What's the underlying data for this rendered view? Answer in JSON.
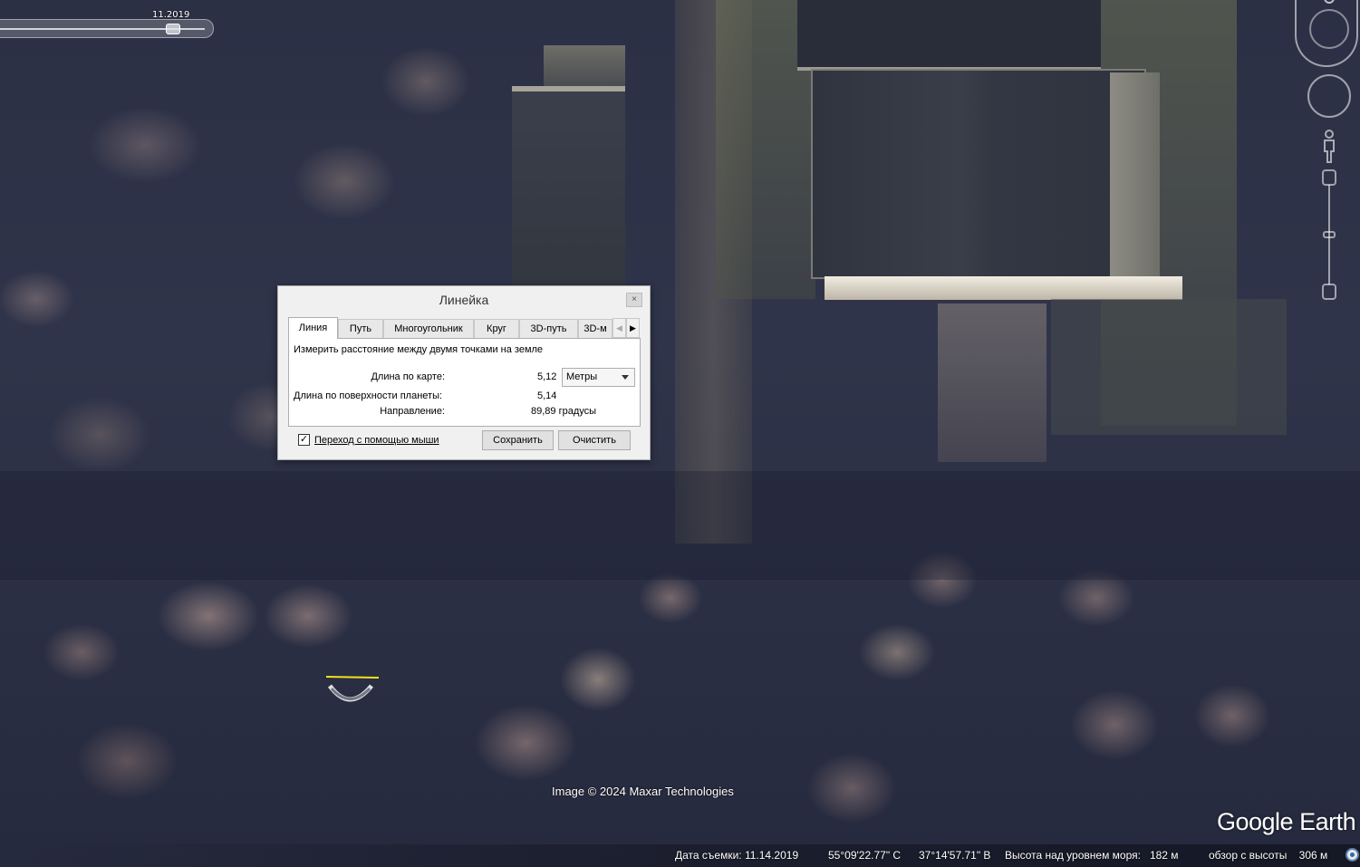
{
  "map": {
    "imagery_date_slider": "11.2019",
    "copyright": "Image © 2024 Maxar Technologies",
    "logo": "Google Earth"
  },
  "ruler": {
    "title": "Линейка",
    "close_icon": "×",
    "tabs": [
      "Линия",
      "Путь",
      "Многоугольник",
      "Круг",
      "3D-путь",
      "3D-м"
    ],
    "active_tab": "Линия",
    "tab_scroll_left": "◀",
    "tab_scroll_right": "▶",
    "description": "Измерить расстояние между двумя точками на земле",
    "map_length_label": "Длина по карте:",
    "map_length_value": "5,12",
    "units": "Метры",
    "ground_length_label": "Длина по поверхности планеты:",
    "ground_length_value": "5,14",
    "heading_label": "Направление:",
    "heading_value": "89,89 градусы",
    "mouse_nav_label": "Переход с помощью мыши",
    "mouse_nav_checked": "✓",
    "save_button": "Сохранить",
    "clear_button": "Очистить"
  },
  "status": {
    "imagery_date": "Дата съемки: 11.14.2019",
    "latitude": "55°09'22.77\" С",
    "longitude": "37°14'57.71\" В",
    "elevation": "Высота над уровнем моря:   182 м",
    "eye_alt": "обзор с высоты    306 м"
  },
  "icons": {
    "compass": "compass-icon",
    "look": "look-joystick-icon",
    "street_view": "pegman-icon",
    "zoom": "zoom-slider-icon",
    "status": "network-status-icon"
  },
  "colors": {
    "measurement_line": "#f2e21a",
    "dialog_bg": "#f0f0f0"
  }
}
